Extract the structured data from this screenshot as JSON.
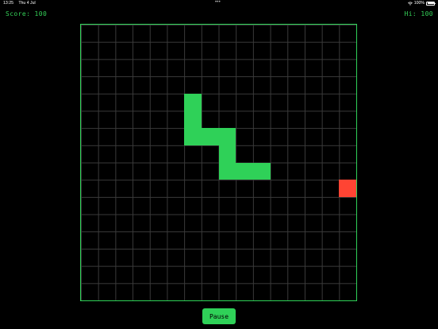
{
  "status_bar": {
    "time": "13:25",
    "date": "Thu 4 Jul",
    "center_dots": "•••",
    "battery": "100%",
    "battery_level": 1.0,
    "icons": [
      "wifi-icon",
      "battery-icon"
    ]
  },
  "hud": {
    "score_text": "Score: 100",
    "hi_text": "Hi: 100"
  },
  "board": {
    "columns": 16,
    "rows": 16,
    "snake": [
      [
        6,
        4
      ],
      [
        6,
        5
      ],
      [
        6,
        6
      ],
      [
        7,
        6
      ],
      [
        8,
        6
      ],
      [
        8,
        7
      ],
      [
        8,
        8
      ],
      [
        9,
        8
      ],
      [
        10,
        8
      ]
    ],
    "food": [
      15,
      9
    ]
  },
  "controls": {
    "pause_label": "Pause"
  },
  "colors": {
    "snake": "#2fd158",
    "food": "#ff4433",
    "text_accent": "#34d058",
    "background": "#000000",
    "grid": "#3a3a3a"
  }
}
